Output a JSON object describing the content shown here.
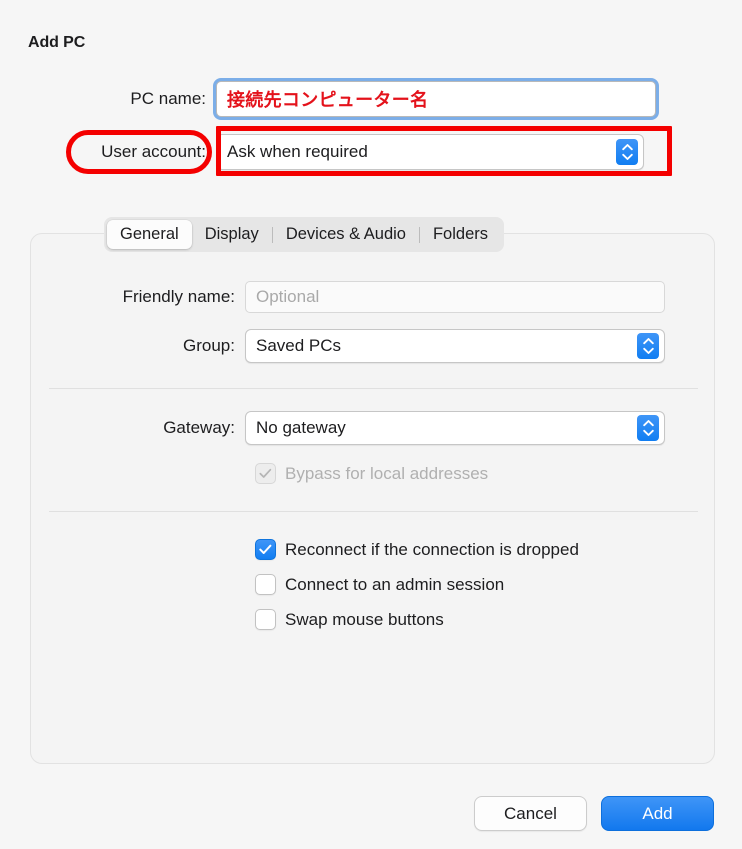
{
  "dialog": {
    "title": "Add PC"
  },
  "form": {
    "pc_name": {
      "label": "PC name:",
      "value": "接続先コンピューター名",
      "placeholder": ""
    },
    "user_account": {
      "label": "User account:",
      "value": "Ask when required"
    }
  },
  "tabs": [
    {
      "label": "General",
      "selected": true
    },
    {
      "label": "Display",
      "selected": false
    },
    {
      "label": "Devices & Audio",
      "selected": false
    },
    {
      "label": "Folders",
      "selected": false
    }
  ],
  "general": {
    "friendly_name": {
      "label": "Friendly name:",
      "value": "",
      "placeholder": "Optional"
    },
    "group": {
      "label": "Group:",
      "value": "Saved PCs"
    },
    "gateway": {
      "label": "Gateway:",
      "value": "No gateway"
    },
    "bypass": {
      "label": "Bypass for local addresses",
      "checked": true,
      "disabled": true
    },
    "options": [
      {
        "label": "Reconnect if the connection is dropped",
        "checked": true
      },
      {
        "label": "Connect to an admin session",
        "checked": false
      },
      {
        "label": "Swap mouse buttons",
        "checked": false
      }
    ]
  },
  "footer": {
    "cancel_label": "Cancel",
    "add_label": "Add"
  },
  "icons": {
    "stepper": "stepper-updown-icon",
    "checkmark": "checkmark-icon"
  },
  "colors": {
    "accent_blue": "#117ef2",
    "annotation_red": "#f40000",
    "focus_ring_blue": "#7caee8",
    "value_red": "#e4121b",
    "window_bg": "#f6f6f6",
    "panel_bg": "#f4f4f4"
  }
}
